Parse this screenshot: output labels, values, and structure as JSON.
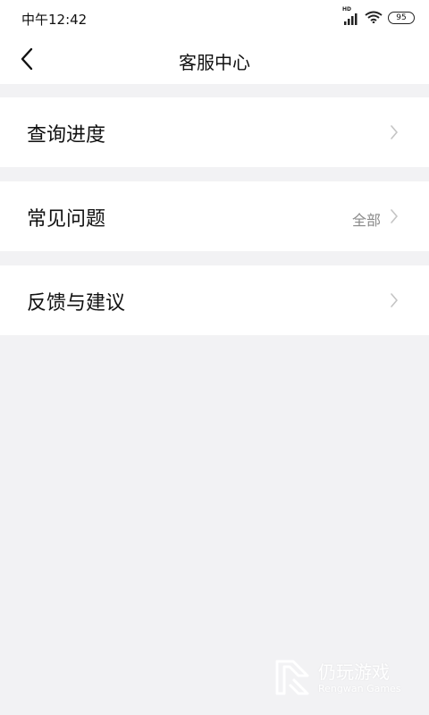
{
  "status_bar": {
    "time": "中午12:42",
    "hd": "HD",
    "battery": "95"
  },
  "nav": {
    "title": "客服中心",
    "back_icon": "chevron-left-icon"
  },
  "menu": {
    "items": [
      {
        "label": "查询进度",
        "extra": "",
        "icon": "chevron-right-icon"
      },
      {
        "label": "常见问题",
        "extra": "全部",
        "icon": "chevron-right-icon"
      },
      {
        "label": "反馈与建议",
        "extra": "",
        "icon": "chevron-right-icon"
      }
    ]
  },
  "watermark": {
    "name": "仍玩游戏",
    "sub": "Rengwan Games"
  },
  "colors": {
    "background": "#f2f2f4",
    "surface": "#ffffff",
    "text": "#111111",
    "secondary_text": "#8a8a8a",
    "chevron": "#c4c4c4"
  }
}
